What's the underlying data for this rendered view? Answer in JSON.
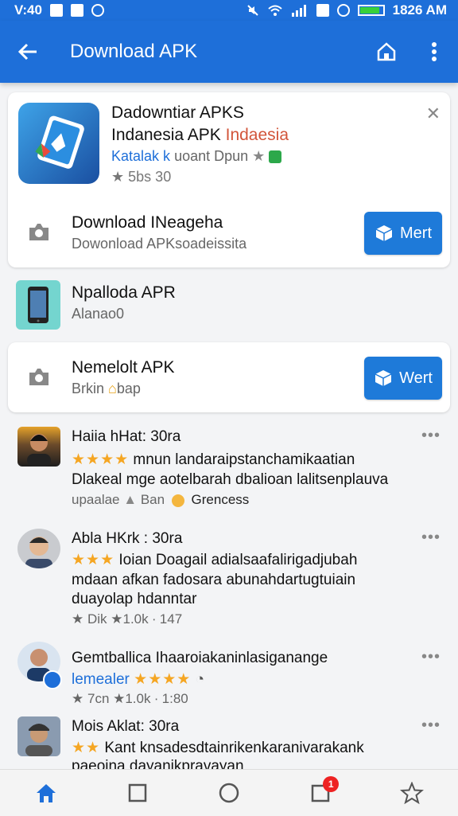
{
  "status_bar": {
    "time_left": "V:40",
    "time_right": "1826 AM"
  },
  "app_bar": {
    "title": "Download APK"
  },
  "featured": {
    "title_line1": "Dadowntiar APKS",
    "title_line2a": "Indanesia APK ",
    "title_line2b": "Indaesia",
    "dev_a": "Katalak k",
    "dev_b": "uoant Dpun",
    "rating": "5bs 30"
  },
  "download_row_1": {
    "title": "Download INeageha",
    "subtitle": "Dowonload APKsoadeissita",
    "button_label": "Mert"
  },
  "app_row": {
    "title": "Npalloda APR",
    "subtitle": "Alanao0"
  },
  "download_row_2": {
    "title": "Nemelolt APK",
    "subtitle": "Brkin ",
    "subtitle_suffix": "bap",
    "button_label": "Wert"
  },
  "reviews": [
    {
      "name": "Haiia hHat: 30ra",
      "line1": "mnun landaraipstanchamikaatian",
      "line2": "Dlakeal mge aotelbarah dbalioan lalitsenplauva",
      "meta_a": "upaalae",
      "meta_b": "Ban",
      "meta_c": "Grencess",
      "stars": "★★★★"
    },
    {
      "name": "Abla HKrk : 30ra",
      "line1": "Ioian Doagail adialsaafalirigadjubah",
      "line2": "mdaan afkan fadosara abunahdartugtuiain",
      "line3": "duayolap hdanntar",
      "meta": "Dik ★1.0k ∙ 147",
      "stars": "★★★"
    },
    {
      "name": "Gemtballica Ihaaroiakaninlasiganange",
      "line1": "lemealer",
      "meta": "7cn ★1.0k ∙ 1:80",
      "stars": "★★★★"
    },
    {
      "name": "Mois Aklat: 30ra",
      "line1": "Kant knsadesdtainrikenkaranivarakank",
      "line2": "paeoina dayanikpravayan",
      "stars": "★★"
    }
  ],
  "colors": {
    "primary": "#1e6fd9",
    "star": "#f5a623",
    "badge": "#e22222"
  },
  "bottom_nav": {
    "badge_count": "1"
  }
}
